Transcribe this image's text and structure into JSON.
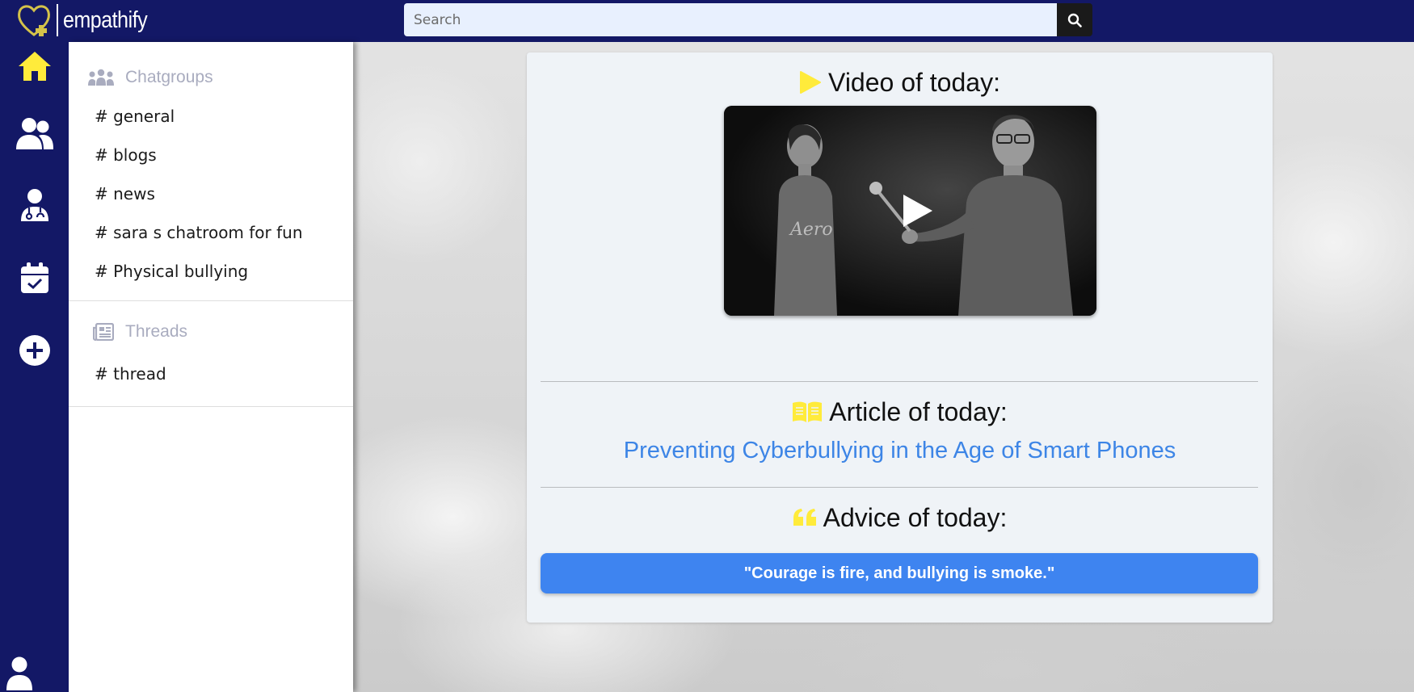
{
  "app": {
    "brand": "empathify"
  },
  "search": {
    "placeholder": "Search"
  },
  "rail": {
    "icons": [
      "home-icon",
      "users-icon",
      "doctor-icon",
      "calendar-check-icon",
      "plus-circle-icon",
      "user-icon"
    ]
  },
  "sidebar": {
    "chatgroups_label": "Chatgroups",
    "chatgroups": [
      "# general",
      "# blogs",
      "# news",
      "# sara s chatroom for fun",
      "# Physical bullying"
    ],
    "threads_label": "Threads",
    "threads": [
      "# thread"
    ]
  },
  "main": {
    "video_heading": "Video of today:",
    "article_heading": "Article of today:",
    "article_title": "Preventing Cyberbullying in the Age of Smart Phones",
    "advice_heading": "Advice of today:",
    "advice_text": "\"Courage is fire, and bullying is smoke.\""
  },
  "colors": {
    "navy": "#131866",
    "accent_yellow": "#ffeb3b",
    "link_blue": "#3d85e6",
    "advice_blue": "#3e84f0"
  }
}
